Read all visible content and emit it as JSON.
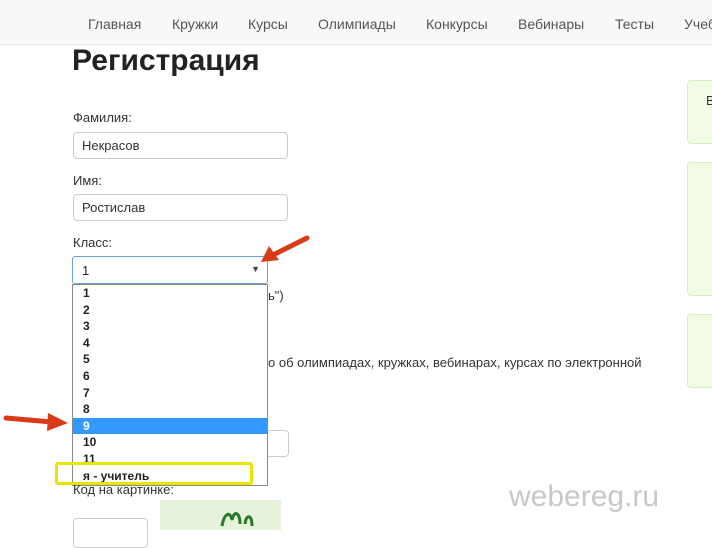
{
  "nav": {
    "items": [
      "Главная",
      "Кружки",
      "Курсы",
      "Олимпиады",
      "Конкурсы",
      "Вебинары",
      "Тесты",
      "Учеб"
    ]
  },
  "page": {
    "title": "Регистрация"
  },
  "form": {
    "surname_label": "Фамилия:",
    "surname_value": "Некрасов",
    "name_label": "Имя:",
    "name_value": "Ростислав",
    "class_label": "Класс:",
    "class_selected": "1",
    "class_options": [
      "1",
      "2",
      "3",
      "4",
      "5",
      "6",
      "7",
      "8",
      "9",
      "10",
      "11",
      "я - учитель"
    ],
    "class_highlighted": "9",
    "hidden_text_1": "ь\")",
    "hidden_text_2": "о об олимпиадах, кружках, вебинарах, курсах по электронной",
    "captcha_label": "Код на картинке:"
  },
  "aside": {
    "card_letter": "В"
  },
  "watermark": "webereg.ru",
  "colors": {
    "selected_option": "#3399ff",
    "highlight_box": "#e8e600",
    "arrow": "#d93a1a",
    "aside_bg": "#f2fbe3"
  }
}
